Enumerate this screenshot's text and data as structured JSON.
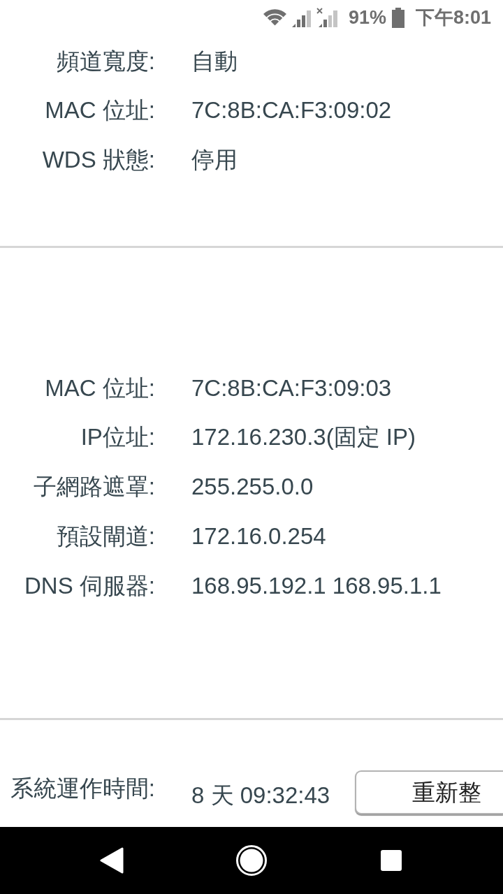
{
  "status_bar": {
    "battery": "91%",
    "time": "下午8:01"
  },
  "sections": [
    {
      "rows": [
        {
          "label": "頻道寬度:",
          "value": "自動"
        },
        {
          "label": "MAC 位址:",
          "value": "7C:8B:CA:F3:09:02"
        },
        {
          "label": "WDS 狀態:",
          "value": "停用"
        }
      ]
    },
    {
      "rows": [
        {
          "label": "MAC 位址:",
          "value": "7C:8B:CA:F3:09:03"
        },
        {
          "label": "IP位址:",
          "value": "172.16.230.3(固定 IP)"
        },
        {
          "label": "子網路遮罩:",
          "value": "255.255.0.0"
        },
        {
          "label": "預設閘道:",
          "value": "172.16.0.254"
        },
        {
          "label": "DNS 伺服器:",
          "value": "168.95.192.1 168.95.1.1"
        }
      ]
    }
  ],
  "uptime": {
    "label": "系統運作時間:",
    "value": "8 天 09:32:43",
    "button": "重新整"
  }
}
